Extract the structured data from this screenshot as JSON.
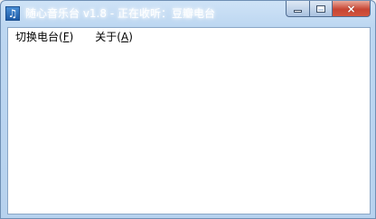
{
  "window": {
    "title": "随心音乐台 v1.8 - 正在收听：豆瓣电台",
    "icon": "music-note-icon",
    "accent": "#bdd7f1",
    "close_color": "#c74533"
  },
  "caption_buttons": {
    "minimize": "minimize-icon",
    "maximize": "maximize-icon",
    "close": "×"
  },
  "menu": {
    "items": [
      {
        "label": "切换电台(",
        "accel": "F",
        "tail": ")"
      },
      {
        "label": "关于(",
        "accel": "A",
        "tail": ")"
      }
    ]
  }
}
